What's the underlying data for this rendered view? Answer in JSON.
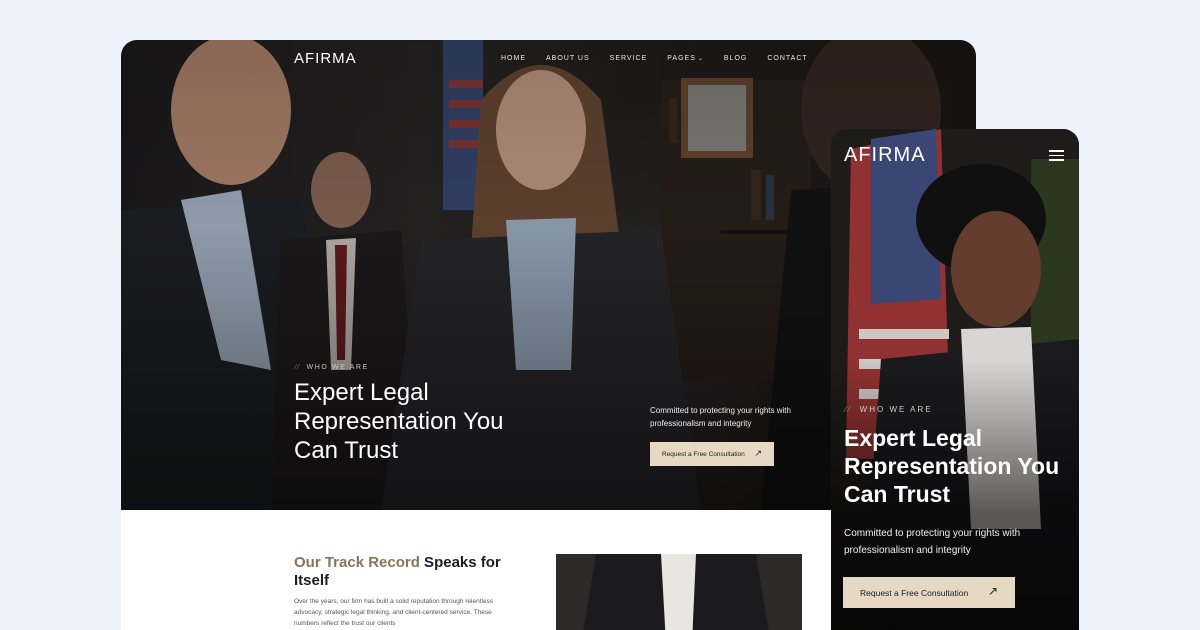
{
  "desktop": {
    "logo": "AFIRMA",
    "nav": [
      "HOME",
      "ABOUT US",
      "SERVICE",
      "PAGES",
      "BLOG",
      "CONTACT"
    ],
    "hero": {
      "eyebrow": "WHO WE ARE",
      "title": "Expert Legal Representation You Can Trust",
      "subtitle": "Committed to protecting your rights with professionalism and integrity",
      "cta": "Request a Free Consultation"
    },
    "track_record": {
      "heading_accent": "Our Track Record",
      "heading_rest": " Speaks for Itself",
      "paragraph": "Over the years, our firm has built a solid reputation through relentless advocacy, strategic legal thinking, and client-centered service. These numbers reflect the trust our clients"
    }
  },
  "mobile": {
    "logo": "AFIRMA",
    "hero": {
      "eyebrow": "WHO WE ARE",
      "title": "Expert Legal Representation You Can Trust",
      "subtitle": "Committed to protecting your rights with professionalism and integrity",
      "cta": "Request a Free Consultation"
    }
  },
  "icons": {
    "eyebrow_mark": "double-slash-icon",
    "cta_arrow": "arrow-up-right-icon",
    "dropdown": "chevron-down-icon",
    "menu": "hamburger-icon"
  },
  "colors": {
    "page_background": "#eef3fb",
    "cta_background": "#e6d9c4",
    "accent_text": "#8a7358"
  }
}
